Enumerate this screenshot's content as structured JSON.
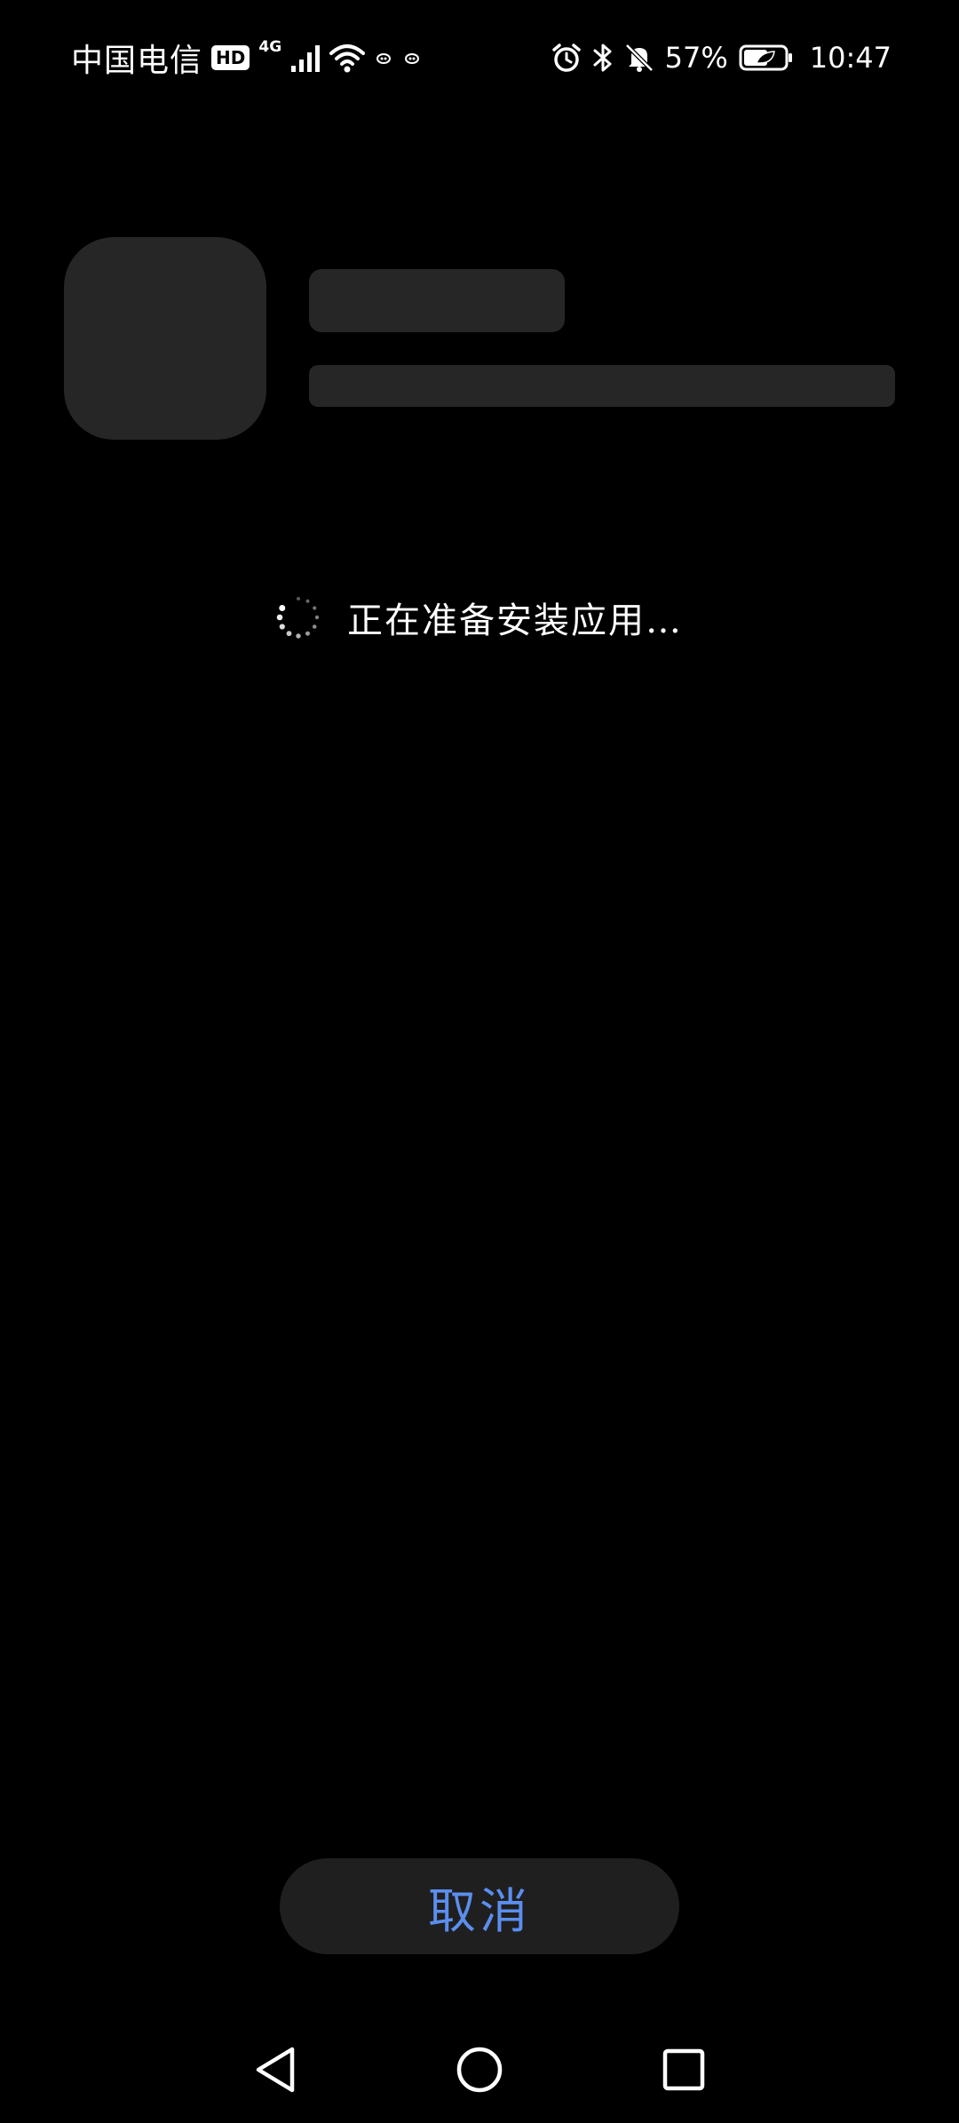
{
  "status_bar": {
    "carrier": "中国电信",
    "hd_badge": "HD",
    "network_type": "4G",
    "battery_percent": "57%",
    "time": "10:47",
    "icons": [
      "signal-icon",
      "wifi-icon",
      "notification-icon",
      "notification-icon",
      "alarm-icon",
      "bluetooth-icon",
      "mute-icon",
      "battery-icon"
    ]
  },
  "install": {
    "status_text": "正在准备安装应用…"
  },
  "actions": {
    "cancel_label": "取消"
  },
  "navigation": {
    "buttons": [
      "back-icon",
      "home-icon",
      "recents-icon"
    ]
  },
  "colors": {
    "background": "#000000",
    "placeholder": "#262626",
    "button_background": "#1f1f1f",
    "accent": "#5b8eee",
    "text": "#ffffff"
  }
}
